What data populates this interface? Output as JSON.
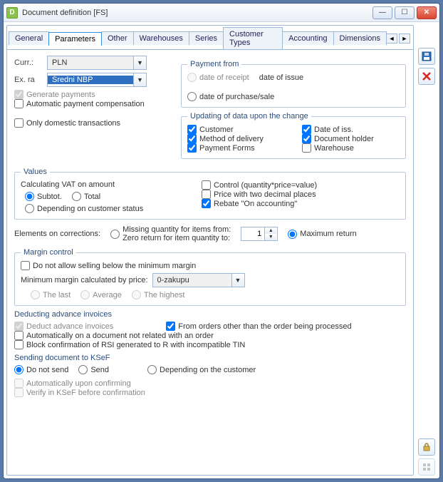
{
  "window": {
    "title": "Document definition [FS]"
  },
  "tabs": [
    "General",
    "Parameters",
    "Other",
    "Warehouses",
    "Series",
    "Customer Types",
    "Accounting",
    "Dimensions"
  ],
  "active_tab": 1,
  "curr": {
    "label": "Curr.:",
    "value": "PLN"
  },
  "exrate": {
    "label": "Ex. ra",
    "value": "Średni NBP"
  },
  "generate_payments": "Generate payments",
  "auto_payment_comp": "Automatic payment compensation",
  "only_domestic": "Only domestic transactions",
  "payment_from": {
    "legend": "Payment from",
    "receipt": "date of receipt",
    "issue": "date of issue",
    "purchase": "date of purchase/sale"
  },
  "updating": {
    "legend": "Updating of data upon the change",
    "customer": "Customer",
    "date_iss": "Date of iss.",
    "method_delivery": "Method of delivery",
    "doc_holder": "Document holder",
    "payment_forms": "Payment Forms",
    "warehouse": "Warehouse"
  },
  "values": {
    "legend": "Values",
    "calc_vat_title": "Calculating VAT on amount",
    "subtot": "Subtot.",
    "total": "Total",
    "depending": "Depending on customer status",
    "control": "Control (quantity*price=value)",
    "price_two": "Price with two decimal places",
    "rebate": "Rebate \"On accounting\""
  },
  "elements_corr": {
    "label": "Elements on corrections:",
    "missing1": "Missing quantity for items from:",
    "missing2": "Zero return for item quantity to:",
    "spin_value": "1",
    "max_return": "Maximum return"
  },
  "margin": {
    "legend": "Margin control",
    "disallow": "Do not allow selling below the minimum margin",
    "min_calc_label": "Minimum margin calculated by price:",
    "combo": "0-zakupu",
    "last": "The last",
    "average": "Average",
    "highest": "The highest"
  },
  "deducting": {
    "legend": "Deducting advance invoices",
    "deduct": "Deduct advance invoices",
    "from_orders": "From orders other than the order being processed",
    "auto_not_related": "Automatically on a document not related with an order",
    "block_rsi": "Block confirmation of RSI generated to R with incompatible TIN"
  },
  "ksef": {
    "legend": "Sending document to KSeF",
    "do_not_send": "Do not send",
    "send": "Send",
    "depending": "Depending on the customer",
    "auto_confirm": "Automatically upon confirming",
    "verify": "Verify in KSeF before confirmation"
  }
}
